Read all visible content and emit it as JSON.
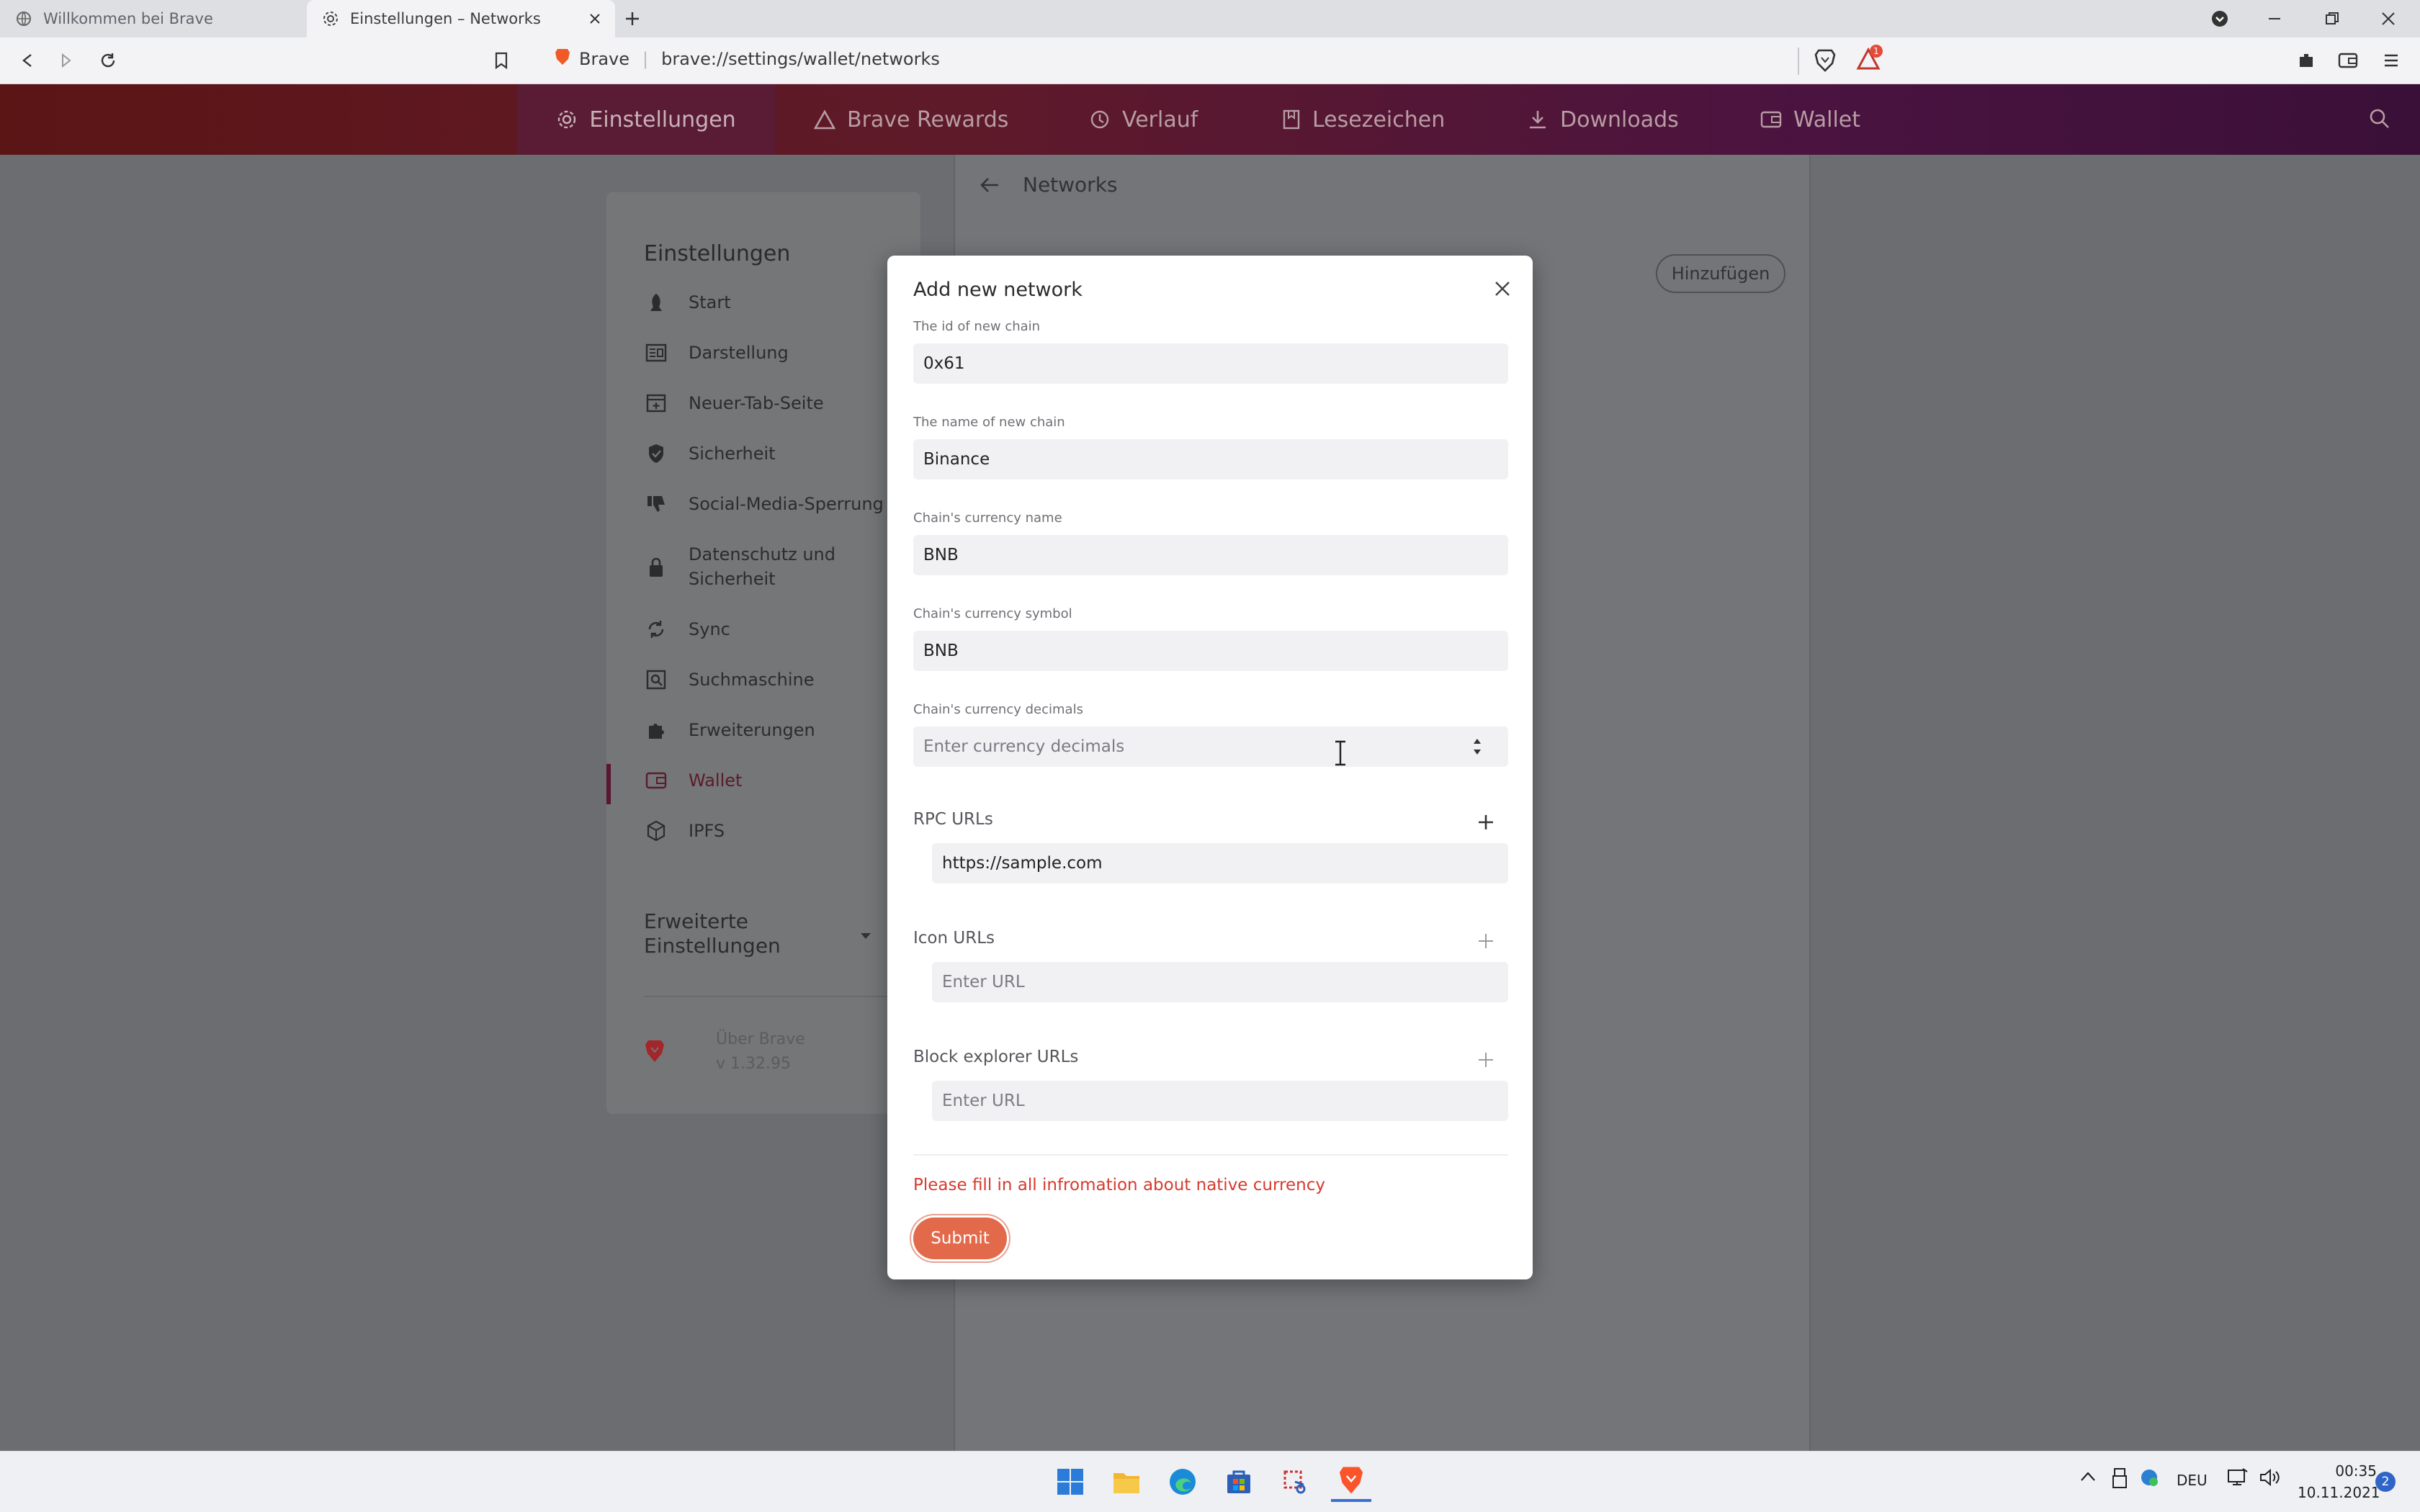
{
  "tabs": [
    {
      "title": "Willkommen bei Brave",
      "active": false
    },
    {
      "title": "Einstellungen – Networks",
      "active": true
    }
  ],
  "address": {
    "site_label": "Brave",
    "url": "brave://settings/wallet/networks"
  },
  "shields_badge": "1",
  "nav": [
    {
      "label": "Einstellungen",
      "icon": "gear-icon",
      "active": true
    },
    {
      "label": "Brave Rewards",
      "icon": "rewards-triangle-icon",
      "active": false
    },
    {
      "label": "Verlauf",
      "icon": "history-icon",
      "active": false
    },
    {
      "label": "Lesezeichen",
      "icon": "bookmark-icon",
      "active": false
    },
    {
      "label": "Downloads",
      "icon": "download-icon",
      "active": false
    },
    {
      "label": "Wallet",
      "icon": "wallet-icon",
      "active": false
    }
  ],
  "sidebar": {
    "title": "Einstellungen",
    "items": [
      {
        "label": "Start",
        "icon": "rocket-icon"
      },
      {
        "label": "Darstellung",
        "icon": "appearance-icon"
      },
      {
        "label": "Neuer-Tab-Seite",
        "icon": "new-tab-icon"
      },
      {
        "label": "Sicherheit",
        "icon": "shield-icon"
      },
      {
        "label": "Social-Media-Sperrung",
        "icon": "thumbs-down-icon"
      },
      {
        "label": "Datenschutz und Sicherheit",
        "icon": "lock-icon"
      },
      {
        "label": "Sync",
        "icon": "sync-icon"
      },
      {
        "label": "Suchmaschine",
        "icon": "search-box-icon"
      },
      {
        "label": "Erweiterungen",
        "icon": "puzzle-icon"
      },
      {
        "label": "Wallet",
        "icon": "wallet-icon",
        "active": true
      },
      {
        "label": "IPFS",
        "icon": "cube-icon"
      }
    ],
    "advanced": "Erweiterte Einstellungen",
    "about": {
      "label": "Über Brave",
      "version": "v 1.32.95"
    }
  },
  "networks_page": {
    "title": "Networks",
    "add_button": "Hinzufügen"
  },
  "modal": {
    "title": "Add new network",
    "fields": [
      {
        "label": "The id of new chain",
        "value": "0x61"
      },
      {
        "label": "The name of new chain",
        "value": "Binance"
      },
      {
        "label": "Chain's currency name",
        "value": "BNB"
      },
      {
        "label": "Chain's currency symbol",
        "value": "BNB"
      },
      {
        "label": "Chain's currency decimals",
        "value": "",
        "placeholder": "Enter currency decimals"
      }
    ],
    "rpc": {
      "label": "RPC URLs",
      "value": "https://sample.com"
    },
    "icon_urls": {
      "label": "Icon URLs",
      "placeholder": "Enter URL"
    },
    "explorer_urls": {
      "label": "Block explorer URLs",
      "placeholder": "Enter URL"
    },
    "error": "Please fill in all infromation about native currency",
    "submit": "Submit"
  },
  "taskbar": {
    "lang": "DEU",
    "time": "00:35",
    "date": "10.11.2021",
    "notifications": "2"
  },
  "colors": {
    "accent": "#e3694b",
    "error": "#d63a2e",
    "header_start": "#5c1515",
    "header_end": "#3a1038"
  }
}
